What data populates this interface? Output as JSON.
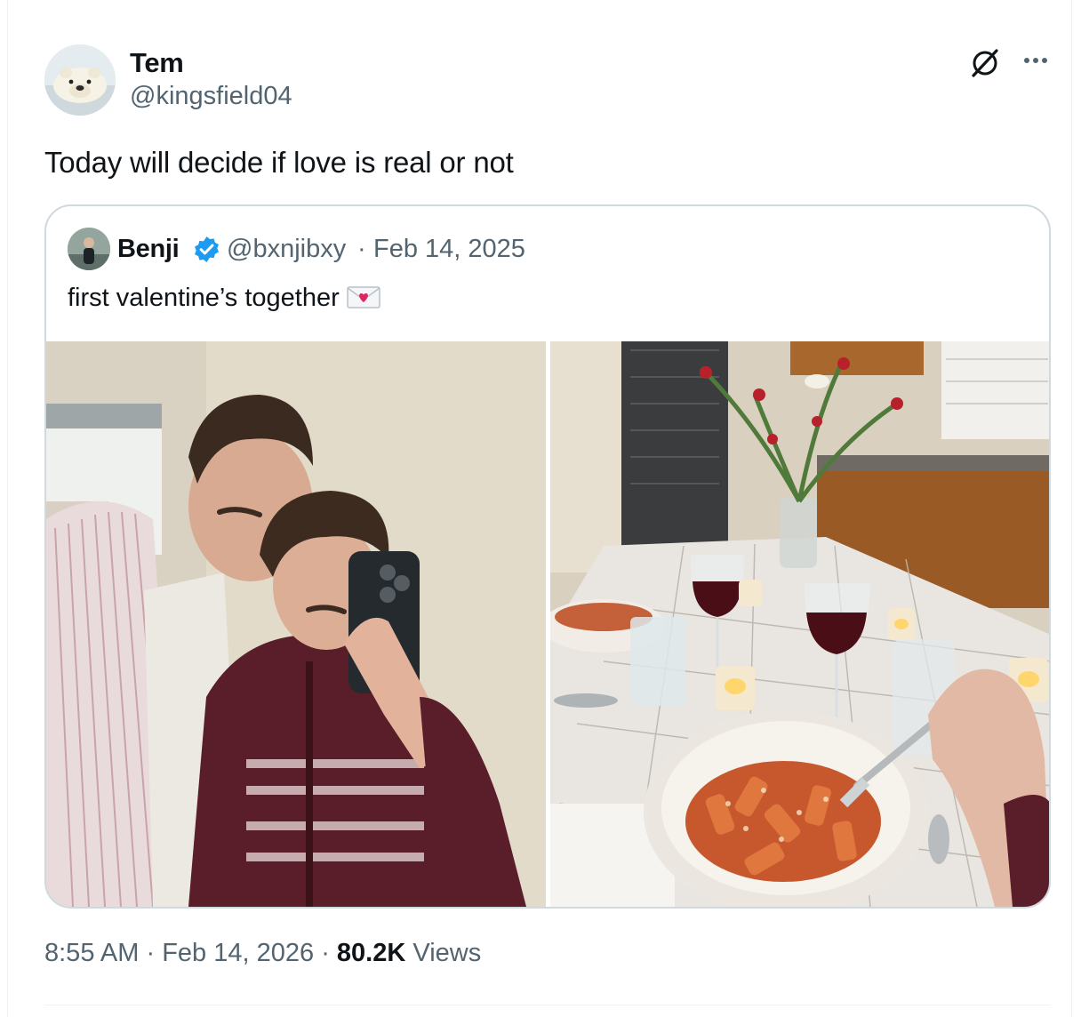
{
  "tweet": {
    "author_name": "Tem",
    "author_handle": "@kingsfield04",
    "text": "Today will decide if love is real or not",
    "more_icon": "more-horizontal-icon",
    "grok_icon": "grok-icon",
    "time": "8:55 AM",
    "sep1": "·",
    "date": "Feb 14, 2026",
    "sep2": "·",
    "views_count": "80.2K",
    "views_label": "Views"
  },
  "quoted": {
    "author_name": "Benji",
    "verified": true,
    "author_handle": "@bxnjibxy",
    "separator": "·",
    "date": "Feb 14, 2025",
    "text": "first valentine’s together",
    "emoji": "love-letter-icon",
    "photos": [
      "couple-mirror-selfie",
      "pasta-candlelit-dinner"
    ]
  },
  "colors": {
    "text_primary": "#0f1419",
    "text_secondary": "#536471",
    "border": "#cfd9de",
    "verified_blue": "#1d9bf0"
  }
}
